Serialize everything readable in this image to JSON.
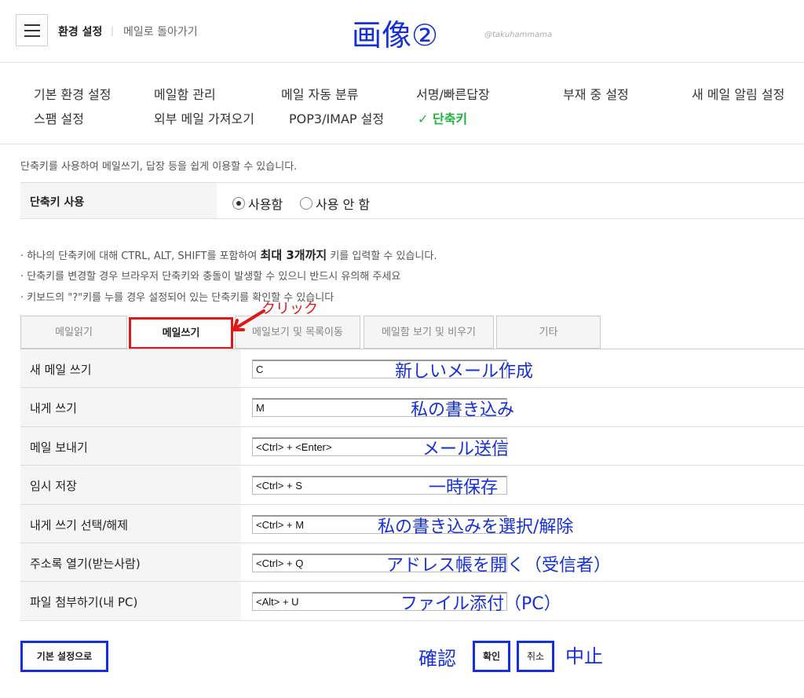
{
  "header": {
    "title": "환경 설정",
    "separator": "|",
    "back_link": "메일로 돌아가기",
    "annotation": "画像②",
    "watermark": "@takuhammama"
  },
  "nav": {
    "items": [
      {
        "label": "기본 환경 설정"
      },
      {
        "label": "메일함 관리"
      },
      {
        "label": "메일 자동 분류"
      },
      {
        "label": "서명/빠른답장"
      },
      {
        "label": "부재 중 설정"
      },
      {
        "label": "새 메일 알림 설정"
      },
      {
        "label": "스팸 설정"
      },
      {
        "label": "외부 메일 가져오기"
      },
      {
        "label": "POP3/IMAP 설정"
      },
      {
        "label": "✓ 단축키"
      }
    ]
  },
  "description": "단축키를 사용하여 메일쓰기, 답장 등을 쉽게 이용할 수 있습니다.",
  "use_setting": {
    "label": "단축키 사용",
    "options": [
      "사용함",
      "사용 안 함"
    ],
    "selected": "사용함"
  },
  "notes": {
    "n1_pre": "· 하나의 단축키에 대해 CTRL, ALT, SHIFT를 포함하여 ",
    "n1_bold": "최대 3개까지",
    "n1_post": " 키를 입력할 수 있습니다.",
    "n2": "· 단축키를 변경할 경우 브라우저 단축키와 충돌이 발생할 수 있으니 반드시 유의해 주세요",
    "n3": "· 키보드의 \"?\"키를 누를 경우 설정되어 있는 단축키를 확인할 수 있습니다"
  },
  "tabs": [
    {
      "label": "메일읽기"
    },
    {
      "label": "메일쓰기"
    },
    {
      "label": "메일보기 및 목록이동"
    },
    {
      "label": "메일함 보기 및 비우기"
    },
    {
      "label": "기타"
    }
  ],
  "click_annotation": "クリック",
  "shortcuts": [
    {
      "label": "새 메일 쓰기",
      "value": "C",
      "note": "新しいメール作成"
    },
    {
      "label": "내게 쓰기",
      "value": "M",
      "note": "私の書き込み"
    },
    {
      "label": "메일 보내기",
      "value": "<Ctrl> + <Enter>",
      "note": "メール送信"
    },
    {
      "label": "임시 저장",
      "value": "<Ctrl> + S",
      "note": "一時保存"
    },
    {
      "label": "내게 쓰기 선택/해제",
      "value": "<Ctrl> + M",
      "note": "私の書き込みを選択/解除"
    },
    {
      "label": "주소록 열기(받는사람)",
      "value": "<Ctrl> + Q",
      "note": "アドレス帳を開く（受信者）"
    },
    {
      "label": "파일 첨부하기(내 PC)",
      "value": "<Alt> + U",
      "note": "ファイル添付（PC）"
    }
  ],
  "footer": {
    "default_button": "기본 설정으로",
    "confirm_annotation": "確認",
    "ok_button": "확인",
    "cancel_button": "취소",
    "cancel_annotation": "中止"
  },
  "colors": {
    "accent_green": "#1fb33e",
    "annotation_blue": "#1530d8",
    "annotation_red": "#e01818"
  }
}
